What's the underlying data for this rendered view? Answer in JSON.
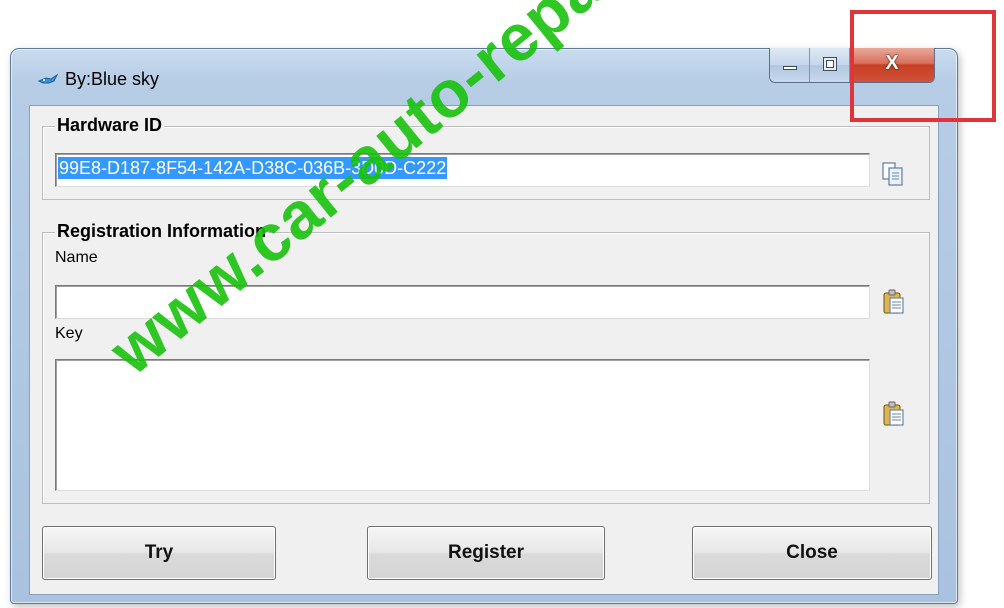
{
  "window": {
    "title": "By:Blue sky",
    "close_glyph": "X",
    "icons": {
      "app": "bird-icon",
      "minimize": "minimize-icon",
      "maximize": "maximize-icon"
    }
  },
  "hardware": {
    "group_title": "Hardware ID",
    "id_value": "99E8-D187-8F54-142A-D38C-036B-3D0D-C222",
    "copy_icon": "copy-icon"
  },
  "registration": {
    "group_title": "Registration Information",
    "name_label": "Name",
    "name_value": "",
    "key_label": "Key",
    "key_value": "",
    "paste_icon": "paste-icon"
  },
  "buttons": {
    "try": "Try",
    "register": "Register",
    "close": "Close"
  },
  "overlay": {
    "watermark": "www.car-auto-repair.com",
    "highlight_color": "#e0343b",
    "watermark_color": "#18c20d",
    "selection_color": "#3399ff"
  }
}
